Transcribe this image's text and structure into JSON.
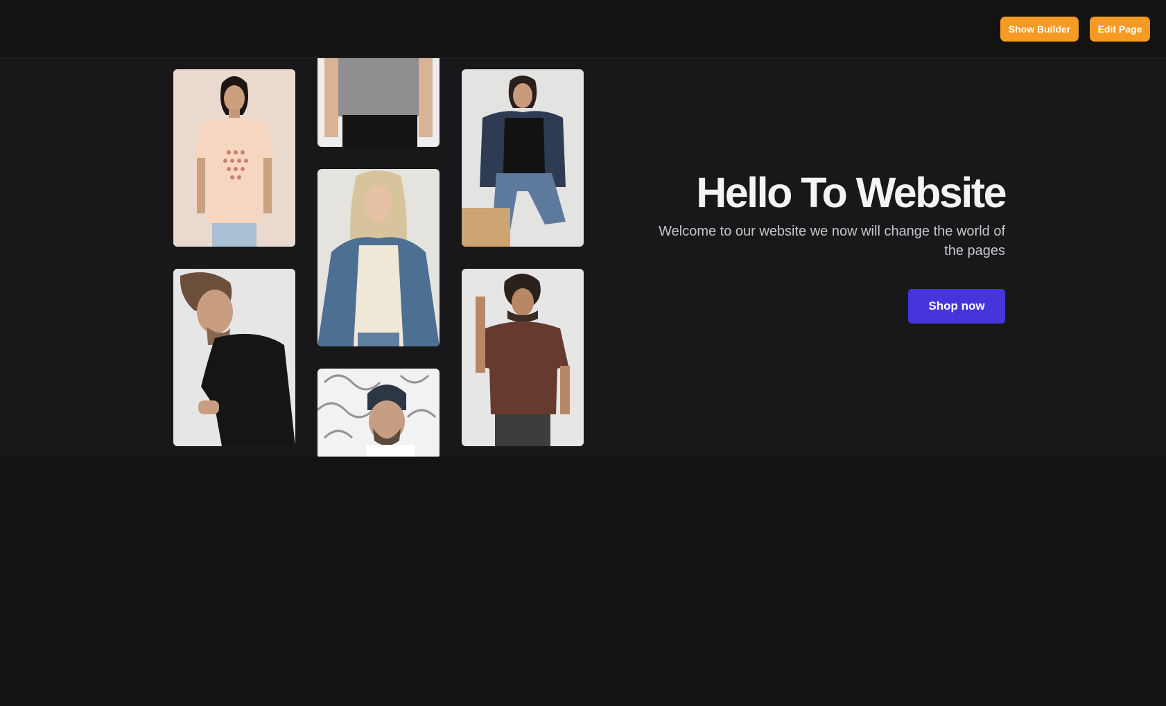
{
  "toolbar": {
    "show_builder_label": "Show Builder",
    "edit_page_label": "Edit Page"
  },
  "hero": {
    "title": "Hello To Website",
    "subtitle": "Welcome to our website we now will change the world of the pages",
    "cta_label": "Shop now"
  },
  "colors": {
    "page_background": "#131313",
    "hero_background": "#18181b",
    "toolbar_button": "#f59a23",
    "cta_button": "#4634dd"
  }
}
